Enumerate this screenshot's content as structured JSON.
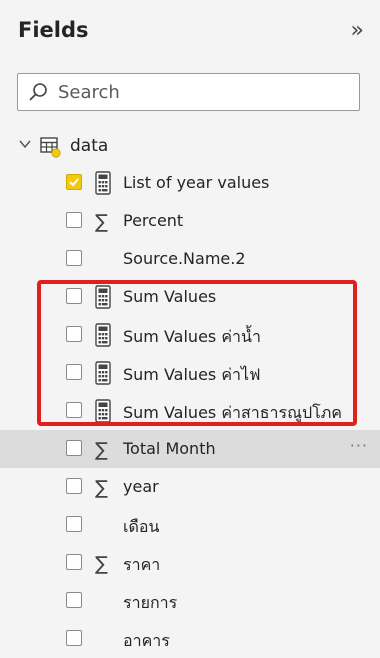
{
  "pane": {
    "title": "Fields",
    "collapse_icon": "»"
  },
  "search": {
    "placeholder": "Search"
  },
  "table": {
    "name": "data",
    "expanded": true
  },
  "fields": [
    {
      "label": "List of year values",
      "type": "measure",
      "checked": true
    },
    {
      "label": "Percent",
      "type": "sum",
      "checked": false
    },
    {
      "label": "Source.Name.2",
      "type": "none",
      "checked": false
    },
    {
      "label": "Sum Values",
      "type": "measure",
      "checked": false
    },
    {
      "label": "Sum Values ค่าน้ำ",
      "type": "measure",
      "checked": false
    },
    {
      "label": "Sum Values ค่าไฟ",
      "type": "measure",
      "checked": false
    },
    {
      "label": "Sum Values ค่าสาธารณูปโภค",
      "type": "measure",
      "checked": false
    },
    {
      "label": "Total Month",
      "type": "sum",
      "checked": false,
      "hovered": true
    },
    {
      "label": "year",
      "type": "sum",
      "checked": false
    },
    {
      "label": "เดือน",
      "type": "none",
      "checked": false
    },
    {
      "label": "ราคา",
      "type": "sum",
      "checked": false
    },
    {
      "label": "รายการ",
      "type": "none",
      "checked": false
    },
    {
      "label": "อาคาร",
      "type": "none",
      "checked": false
    }
  ],
  "more_options_glyph": "···",
  "colors": {
    "highlight_box": "#e0201a",
    "checkbox_checked": "#f2c811",
    "hover_row": "#dcdcdc"
  }
}
